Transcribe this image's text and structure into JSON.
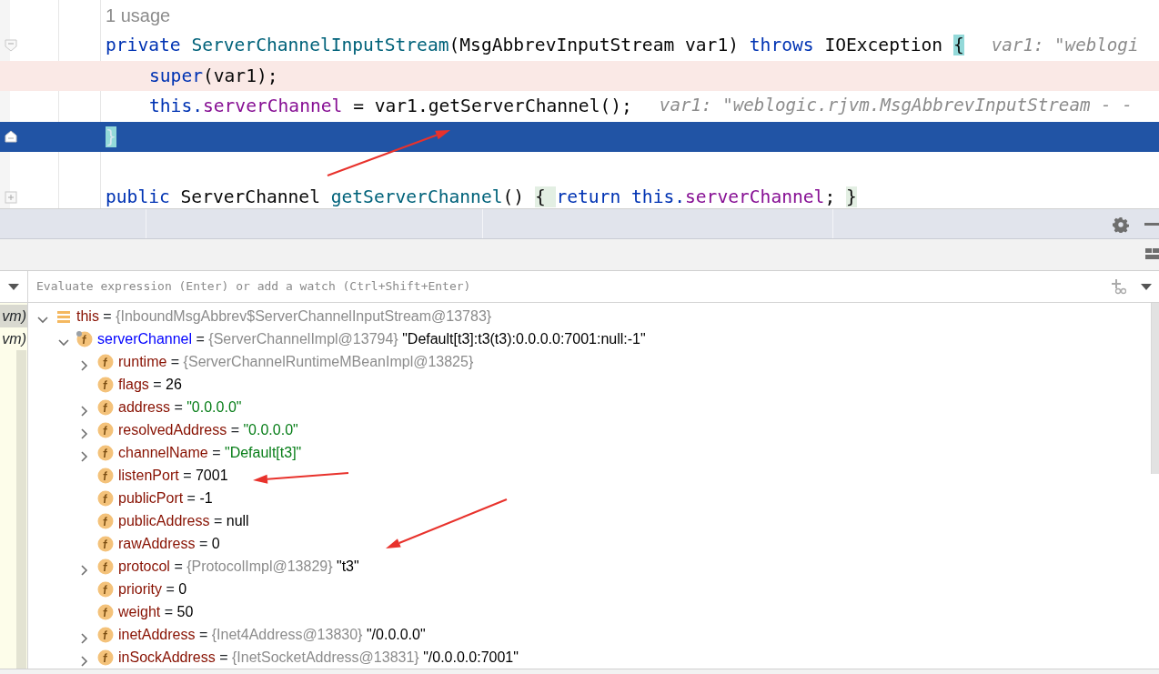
{
  "editor": {
    "lines": [
      {
        "kind": "usage",
        "breakpoint": false,
        "current": false,
        "tokens": [
          {
            "kind": "usage",
            "text": "1 usage"
          }
        ]
      },
      {
        "kind": "decl",
        "breakpoint": false,
        "current": false,
        "fold_start": true,
        "tokens": [
          {
            "kind": "kw",
            "text": "private "
          },
          {
            "kind": "decl",
            "text": "ServerChannelInputStream"
          },
          {
            "kind": "plain",
            "text": "(MsgAbbrevInputStream var1) "
          },
          {
            "kind": "kw",
            "text": "throws "
          },
          {
            "kind": "plain",
            "text": "IOException "
          },
          {
            "kind": "match",
            "text": "{"
          }
        ],
        "hint": "var1: \"weblogi"
      },
      {
        "kind": "body",
        "breakpoint": true,
        "current": false,
        "tokens": [
          {
            "kind": "kw",
            "text": "super"
          },
          {
            "kind": "plain",
            "text": "(var1);"
          }
        ]
      },
      {
        "kind": "body",
        "breakpoint": false,
        "current": false,
        "tokens": [
          {
            "kind": "kw",
            "text": "this."
          },
          {
            "kind": "field",
            "text": "serverChannel"
          },
          {
            "kind": "plain",
            "text": " = var1.getServerChannel();"
          }
        ],
        "hint": "var1: \"weblogic.rjvm.MsgAbbrevInputStream - -"
      },
      {
        "kind": "decl",
        "breakpoint": false,
        "current": true,
        "fold_end": true,
        "tokens": [
          {
            "kind": "match",
            "text": "}"
          }
        ]
      },
      {
        "kind": "blank"
      },
      {
        "kind": "decl",
        "breakpoint": false,
        "current": false,
        "collapsed": true,
        "tokens": [
          {
            "kind": "kw",
            "text": "public "
          },
          {
            "kind": "plain",
            "text": "ServerChannel "
          },
          {
            "kind": "decl",
            "text": "getServerChannel"
          },
          {
            "kind": "plain",
            "text": "() "
          },
          {
            "kind": "folded",
            "text": "{ "
          },
          {
            "kind": "kw",
            "text": "return this."
          },
          {
            "kind": "field",
            "text": "serverChannel"
          },
          {
            "kind": "plain",
            "text": "; "
          },
          {
            "kind": "folded",
            "text": "}"
          }
        ]
      }
    ]
  },
  "debugger": {
    "evaluate": {
      "placeholder": "Evaluate expression (Enter) or add a watch (Ctrl+Shift+Enter)"
    },
    "frames": [
      {
        "text": "vm)",
        "selected": true
      },
      {
        "text": "vm)",
        "selected": false
      }
    ],
    "variables": [
      {
        "kind": "object",
        "name": "this",
        "equals": "=",
        "type_ref": "{InboundMsgAbbrev$ServerChannelInputStream@13783}",
        "expanded": true,
        "changed": false,
        "children": [
          {
            "kind": "watched",
            "name": "serverChannel",
            "equals": "=",
            "type_ref": "{ServerChannelImpl@13794}",
            "value": "\"Default[t3]:t3(t3):0.0.0.0:7001:null:-1\"",
            "is_string": false,
            "expanded": true,
            "changed": true,
            "children": [
              {
                "kind": "field",
                "name": "runtime",
                "equals": "=",
                "type_ref": "{ServerChannelRuntimeMBeanImpl@13825}",
                "expanded": false,
                "changed": false
              },
              {
                "kind": "field",
                "name": "flags",
                "equals": "=",
                "value": "26",
                "is_string": false,
                "changed": false
              },
              {
                "kind": "field",
                "name": "address",
                "equals": "=",
                "value": "\"0.0.0.0\"",
                "is_string": true,
                "expanded": false,
                "changed": false
              },
              {
                "kind": "field",
                "name": "resolvedAddress",
                "equals": "=",
                "value": "\"0.0.0.0\"",
                "is_string": true,
                "expanded": false,
                "changed": false
              },
              {
                "kind": "field",
                "name": "channelName",
                "equals": "=",
                "value": "\"Default[t3]\"",
                "is_string": true,
                "expanded": false,
                "changed": false
              },
              {
                "kind": "field",
                "name": "listenPort",
                "equals": "=",
                "value": "7001",
                "is_string": false,
                "changed": false
              },
              {
                "kind": "field",
                "name": "publicPort",
                "equals": "=",
                "value": "-1",
                "is_string": false,
                "changed": false
              },
              {
                "kind": "field",
                "name": "publicAddress",
                "equals": "=",
                "value": "null",
                "is_string": false,
                "changed": false
              },
              {
                "kind": "field",
                "name": "rawAddress",
                "equals": "=",
                "value": "0",
                "is_string": false,
                "changed": false
              },
              {
                "kind": "field",
                "name": "protocol",
                "equals": "=",
                "type_ref": "{ProtocolImpl@13829}",
                "value": "\"t3\"",
                "is_string": false,
                "expanded": false,
                "changed": false
              },
              {
                "kind": "field",
                "name": "priority",
                "equals": "=",
                "value": "0",
                "is_string": false,
                "changed": false
              },
              {
                "kind": "field",
                "name": "weight",
                "equals": "=",
                "value": "50",
                "is_string": false,
                "changed": false
              },
              {
                "kind": "field",
                "name": "inetAddress",
                "equals": "=",
                "type_ref": "{Inet4Address@13830}",
                "value": "\"/0.0.0.0\"",
                "is_string": false,
                "expanded": false,
                "changed": false
              },
              {
                "kind": "field",
                "name": "inSockAddress",
                "equals": "=",
                "type_ref": "{InetSocketAddress@13831}",
                "value": "\"/0.0.0.0:7001\"",
                "is_string": false,
                "expanded": false,
                "changed": false
              }
            ]
          }
        ]
      }
    ]
  }
}
